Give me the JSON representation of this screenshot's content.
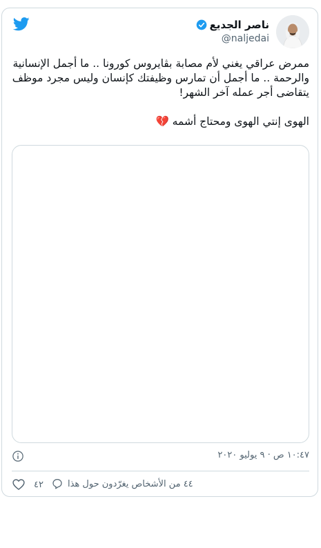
{
  "tweet": {
    "display_name": "ناصر الجديع",
    "handle": "@naljedai",
    "lines": [
      "ممرض عراقي يغني لأم مصابة بڤايروس كورونا .. ما أجمل الإنسانية",
      "والرحمة .. ما أجمل أن تمارس وظيفتك كإنسان وليس مجرد موظف",
      "يتقاضى أجر عمله آخر الشهر!"
    ],
    "line4": "الهوى إنتي الهوى ومحتاج أشمه 💔",
    "timestamp": "١٠:٤٧ ص · ٩ يوليو ٢٠٢٠",
    "like_count": "٤٢",
    "reply_text": "٤٤ من الأشخاص يغرّدون حول هذا"
  },
  "colors": {
    "brand_blue": "#1d9bf0",
    "border": "#cfd9de",
    "secondary_text": "#536471",
    "heart_broken": "#dd2e44"
  },
  "icons": [
    "twitter-bird-icon",
    "verified-badge-icon",
    "info-icon",
    "heart-icon",
    "reply-icon",
    "broken-heart-emoji"
  ]
}
